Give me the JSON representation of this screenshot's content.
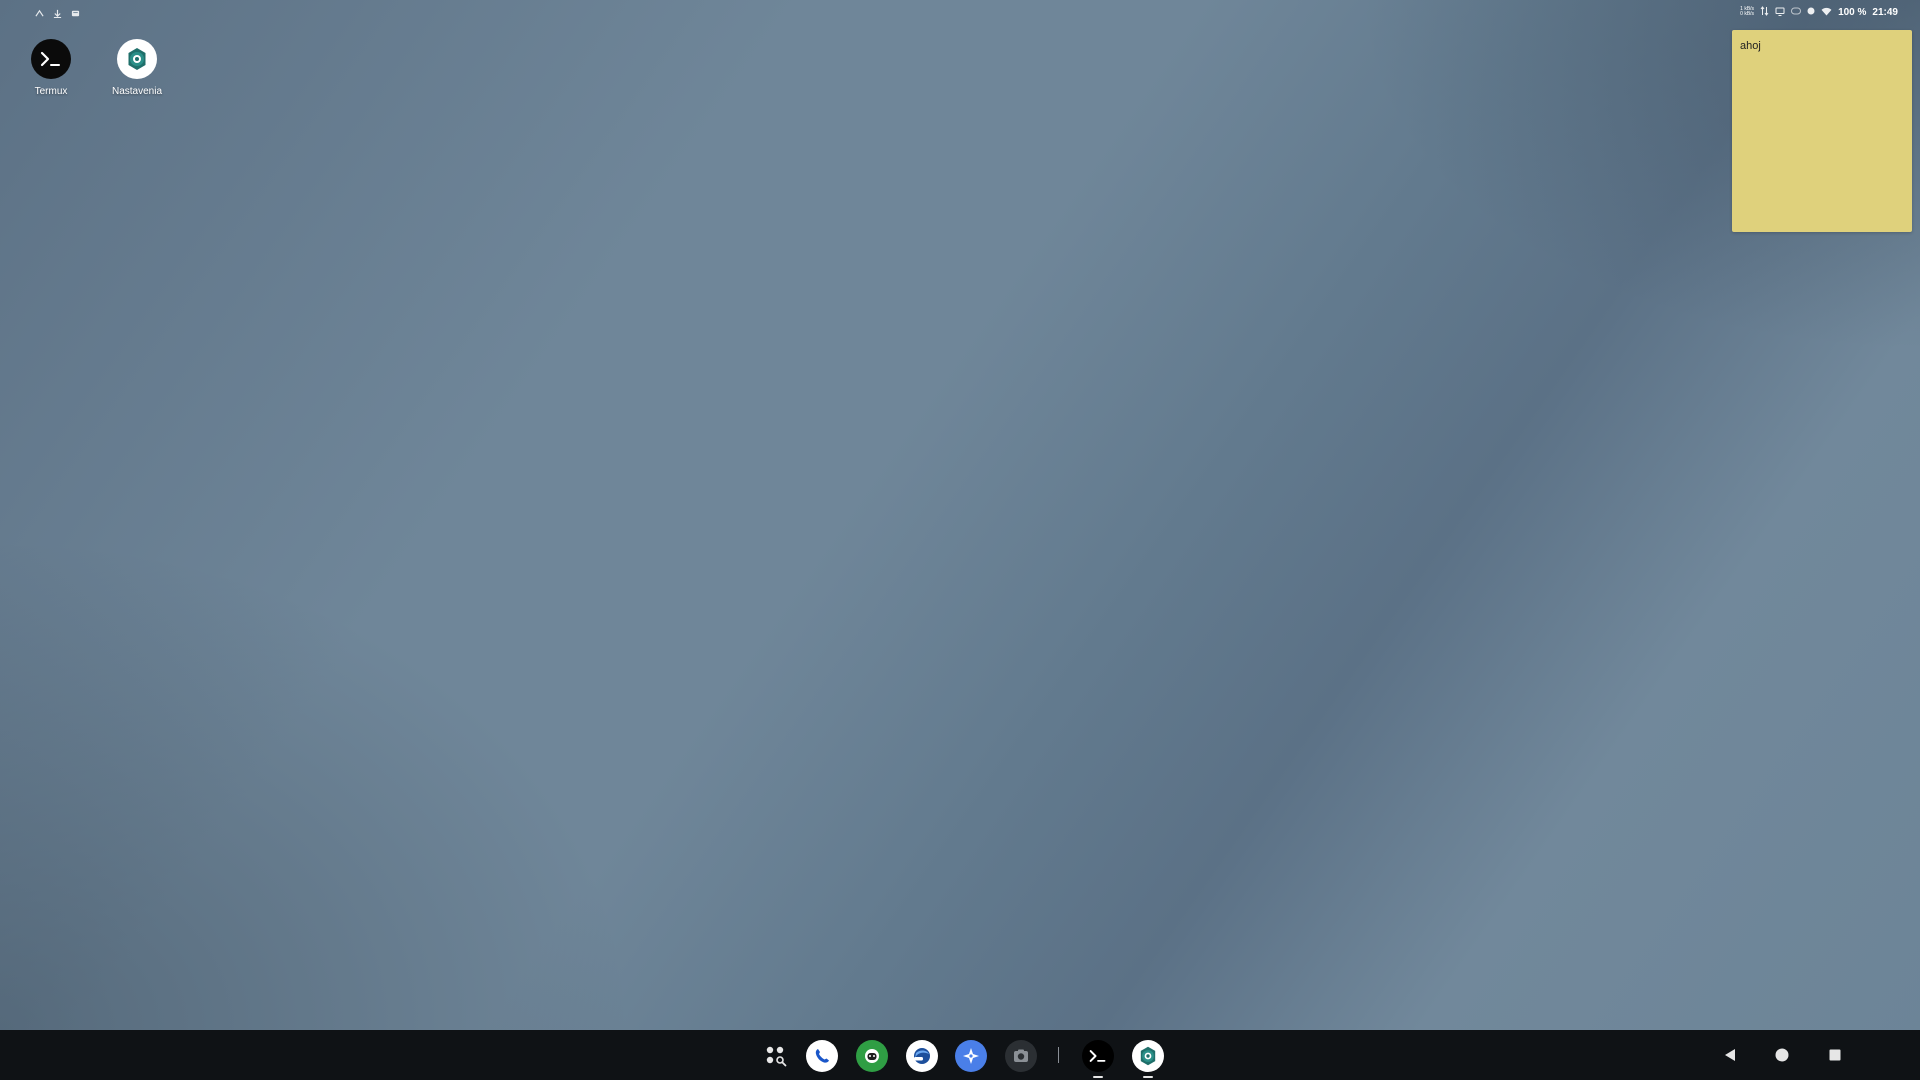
{
  "status_bar": {
    "left_icons": [
      "download-progress-icon",
      "download-icon",
      "notification-icon"
    ],
    "net_speed_up": "1 kB/s",
    "net_speed_down": "0 kB/s",
    "battery": "100 %",
    "time": "21:49"
  },
  "desktop": {
    "icons": [
      {
        "label": "Termux",
        "icon": "terminal-icon"
      },
      {
        "label": "Nastavenia",
        "icon": "settings-gear-icon"
      }
    ],
    "sticky_note": {
      "text": "ahoj"
    }
  },
  "taskbar": {
    "pinned": [
      "app-drawer-icon",
      "phone-icon",
      "android-icon",
      "browser-icon",
      "compass-icon",
      "camera-icon"
    ],
    "running": [
      "terminal-icon",
      "settings-gear-icon"
    ],
    "nav": [
      "back-icon",
      "home-icon",
      "recents-icon"
    ]
  },
  "colors": {
    "sticky_note": "#dfd17c",
    "taskbar": "#0f1215",
    "wallpaper": "#6f8699",
    "android_green": "#2f9e44",
    "compass_blue": "#4a7fe8",
    "settings_teal": "#2a8f88"
  }
}
